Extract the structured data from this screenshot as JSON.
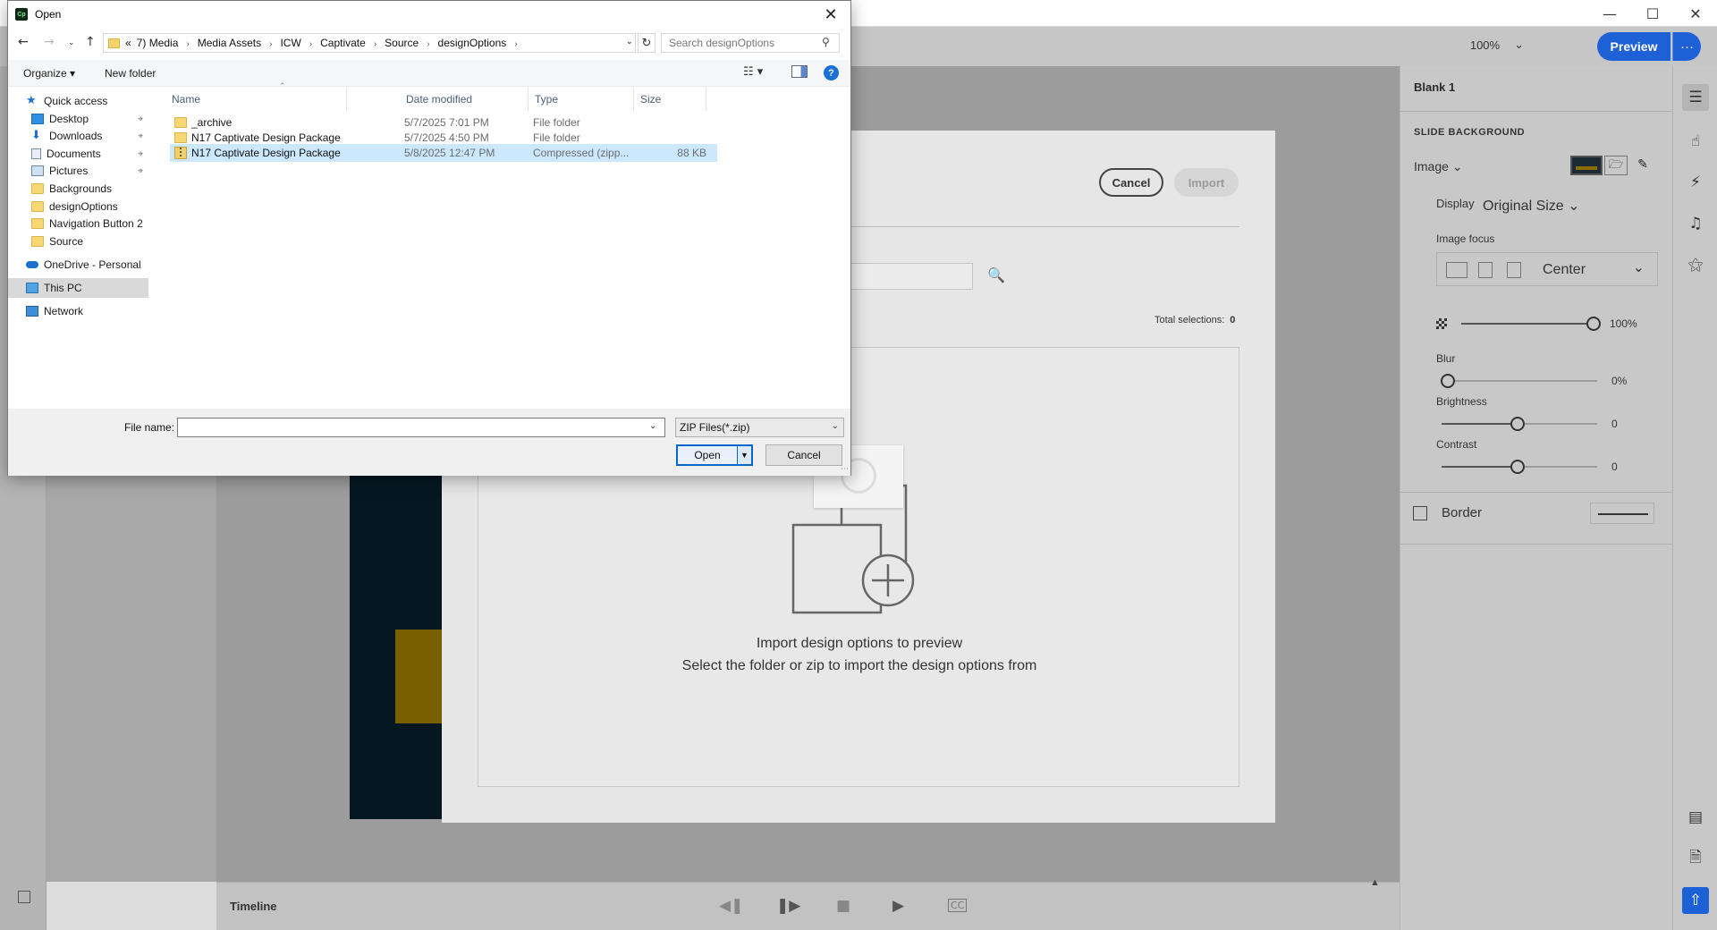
{
  "app": {
    "zoom": "100%",
    "preview_label": "Preview",
    "more_label": "···"
  },
  "modal": {
    "cancel_label": "Cancel",
    "import_label": "Import",
    "total_selections_label": "Total selections:",
    "total_selections_value": "0",
    "dropzone_title": "Import design options to preview",
    "dropzone_subtitle": "Select the folder or zip to import the design options from"
  },
  "timeline": {
    "label": "Timeline"
  },
  "properties": {
    "title": "Blank 1",
    "section": "SLIDE BACKGROUND",
    "bg_type": "Image",
    "display_label": "Display",
    "display_value": "Original Size",
    "focus_label": "Image focus",
    "focus_value": "Center",
    "opacity_value": "100%",
    "blur_label": "Blur",
    "blur_value": "0%",
    "brightness_label": "Brightness",
    "brightness_value": "0",
    "contrast_label": "Contrast",
    "contrast_value": "0",
    "border_label": "Border",
    "levels": {
      "opacity": 1.0,
      "blur": 0.0,
      "brightness": 0.5,
      "contrast": 0.5
    }
  },
  "dialog": {
    "title": "Open",
    "app_icon": "Cp",
    "breadcrumb": [
      "«",
      "7) Media",
      "Media Assets",
      "ICW",
      "Captivate",
      "Source",
      "designOptions"
    ],
    "search_placeholder": "Search designOptions",
    "organize_label": "Organize ▾",
    "new_folder_label": "New folder",
    "help_label": "?",
    "nav": [
      {
        "label": "Quick access",
        "icon": "star-icon",
        "pinned": false
      },
      {
        "label": "Desktop",
        "icon": "desktop-icon",
        "pinned": true
      },
      {
        "label": "Downloads",
        "icon": "download-icon",
        "pinned": true
      },
      {
        "label": "Documents",
        "icon": "documents-icon",
        "pinned": true
      },
      {
        "label": "Pictures",
        "icon": "pictures-icon",
        "pinned": true
      },
      {
        "label": "Backgrounds",
        "icon": "folder-icon",
        "pinned": false
      },
      {
        "label": "designOptions",
        "icon": "folder-icon",
        "pinned": false
      },
      {
        "label": "Navigation Button 2",
        "icon": "folder-icon",
        "pinned": false
      },
      {
        "label": "Source",
        "icon": "folder-icon",
        "pinned": false
      },
      {
        "label": "OneDrive - Personal",
        "icon": "onedrive-icon",
        "pinned": false
      },
      {
        "label": "This PC",
        "icon": "this-pc-icon",
        "pinned": false,
        "selected": true
      },
      {
        "label": "Network",
        "icon": "network-icon",
        "pinned": false
      }
    ],
    "columns": [
      "Name",
      "Date modified",
      "Type",
      "Size"
    ],
    "files": [
      {
        "name": "_archive",
        "date": "5/7/2025 7:01 PM",
        "type": "File folder",
        "size": "",
        "kind": "folder"
      },
      {
        "name": "N17 Captivate Design Package",
        "date": "5/7/2025 4:50 PM",
        "type": "File folder",
        "size": "",
        "kind": "folder"
      },
      {
        "name": "N17 Captivate Design Package",
        "date": "5/8/2025 12:47 PM",
        "type": "Compressed (zipp...",
        "size": "88 KB",
        "kind": "zip",
        "selected": true
      }
    ],
    "filename_label": "File name:",
    "filename_value": "",
    "filetype_value": "ZIP Files(*.zip)",
    "open_label": "Open",
    "cancel_label": "Cancel"
  }
}
